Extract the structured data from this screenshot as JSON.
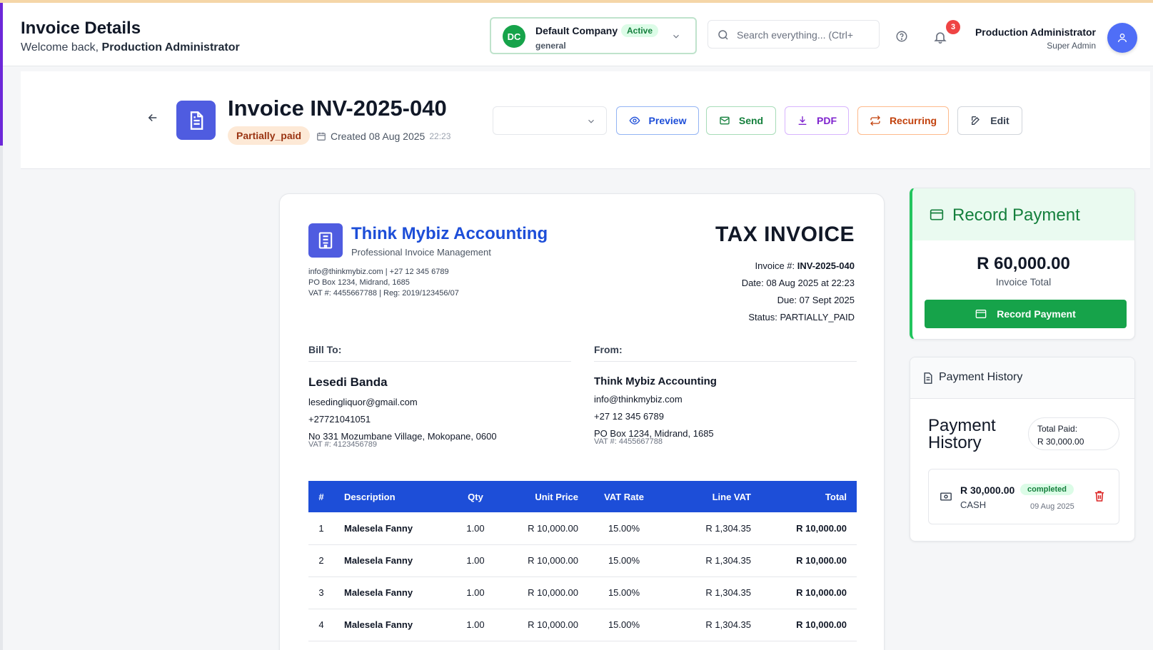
{
  "header": {
    "title": "Invoice Details",
    "welcome_prefix": "Welcome back, ",
    "welcome_user": "Production Administrator",
    "company": {
      "initials": "DC",
      "name": "Default Company",
      "status": "Active",
      "type": "general"
    },
    "search_placeholder": "Search everything... (Ctrl+",
    "notification_count": "3",
    "user_name": "Production Administrator",
    "user_role": "Super Admin"
  },
  "invoice_bar": {
    "title": "Invoice INV-2025-040",
    "status": "Partially_paid",
    "created": "Created 08 Aug 2025",
    "created_time": "22:23",
    "select_value": "",
    "buttons": {
      "preview": "Preview",
      "send": "Send",
      "pdf": "PDF",
      "recurring": "Recurring",
      "edit": "Edit"
    }
  },
  "document": {
    "business_name": "Think Mybiz Accounting",
    "business_tagline": "Professional Invoice Management",
    "business_lines": [
      "info@thinkmybiz.com | +27 12 345 6789",
      "PO Box 1234, Midrand, 1685",
      "VAT #: 4455667788 | Reg: 2019/123456/07"
    ],
    "doc_title": "TAX INVOICE",
    "meta": {
      "invoice_label": "Invoice #: ",
      "invoice_no": "INV-2025-040",
      "date": "Date: 08 Aug 2025 at 22:23",
      "due": "Due: 07 Sept 2025",
      "status": "Status: PARTIALLY_PAID"
    },
    "bill_to": {
      "heading": "Bill To:",
      "name": "Lesedi Banda",
      "email": "lesedingliquor@gmail.com",
      "phone": "+27721041051",
      "address": "No 331 Mozumbane Village, Mokopane, 0600",
      "vat": "VAT #: 4123456789"
    },
    "from": {
      "heading": "From:",
      "name": "Think Mybiz Accounting",
      "email": "info@thinkmybiz.com",
      "phone": "+27 12 345 6789",
      "address": "PO Box 1234, Midrand, 1685",
      "vat": "VAT #: 4455667788"
    },
    "table": {
      "headers": [
        "#",
        "Description",
        "Qty",
        "Unit Price",
        "VAT Rate",
        "Line VAT",
        "Total"
      ],
      "rows": [
        [
          "1",
          "Malesela Fanny",
          "1.00",
          "R 10,000.00",
          "15.00%",
          "R 1,304.35",
          "R 10,000.00"
        ],
        [
          "2",
          "Malesela Fanny",
          "1.00",
          "R 10,000.00",
          "15.00%",
          "R 1,304.35",
          "R 10,000.00"
        ],
        [
          "3",
          "Malesela Fanny",
          "1.00",
          "R 10,000.00",
          "15.00%",
          "R 1,304.35",
          "R 10,000.00"
        ],
        [
          "4",
          "Malesela Fanny",
          "1.00",
          "R 10,000.00",
          "15.00%",
          "R 1,304.35",
          "R 10,000.00"
        ]
      ]
    }
  },
  "record_payment": {
    "title": "Record Payment",
    "amount": "R 60,000.00",
    "amount_label": "Invoice Total",
    "button": "Record Payment"
  },
  "payment_history": {
    "header": "Payment History",
    "title": "Payment History",
    "total_paid_label": "Total Paid:",
    "total_paid": "R 30,000.00",
    "entries": [
      {
        "amount": "R 30,000.00",
        "method": "CASH",
        "status": "completed",
        "date": "09 Aug 2025"
      }
    ]
  },
  "colors": {
    "primary": "#1d4ed8",
    "success": "#16a34a",
    "danger": "#ef4444",
    "status_pill": "#fde9d6"
  },
  "icons": [
    "chevron-down-icon",
    "search-icon",
    "help-icon",
    "bell-icon",
    "user-icon",
    "back-arrow-icon",
    "document-icon",
    "calendar-icon",
    "eye-icon",
    "mail-icon",
    "download-icon",
    "repeat-icon",
    "edit-icon",
    "building-icon",
    "credit-card-icon",
    "receipt-icon",
    "cash-icon",
    "trash-icon"
  ]
}
